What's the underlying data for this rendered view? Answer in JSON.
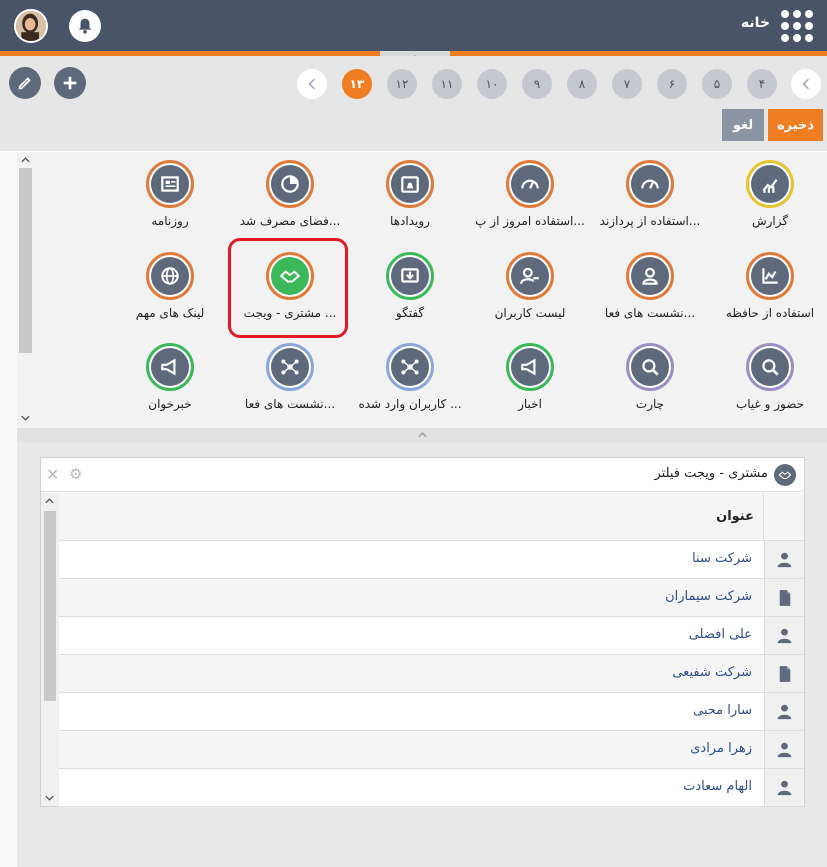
{
  "header": {
    "home_label": "خانه",
    "bell_icon": "bell-icon",
    "grid_icon": "grid-menu-icon"
  },
  "toolbar": {
    "pages": [
      "۱۳",
      "۱۲",
      "۱۱",
      "۱۰",
      "۹",
      "۸",
      "۷",
      "۶",
      "۵",
      "۴"
    ],
    "active_page": "۱۳",
    "save_label": "ذخیره",
    "cancel_label": "لغو"
  },
  "widgets": [
    {
      "label": "گزارش",
      "icon": "chart-up-icon",
      "ring": "#e8c230"
    },
    {
      "label": "استفاده از پردازند...",
      "icon": "gauge-icon",
      "ring": "#e07a3a"
    },
    {
      "label": "استفاده امروز از پ...",
      "icon": "gauge-icon",
      "ring": "#e07a3a"
    },
    {
      "label": "رویدادها",
      "icon": "calendar-bell-icon",
      "ring": "#e07a3a"
    },
    {
      "label": "فضای مصرف شد...",
      "icon": "disk-icon",
      "ring": "#e07a3a"
    },
    {
      "label": "روزنامه",
      "icon": "newspaper-icon",
      "ring": "#e07a3a"
    },
    {
      "label": "استفاده از حافظه",
      "icon": "memory-chart-icon",
      "ring": "#e07a3a"
    },
    {
      "label": "نشست های فعا...",
      "icon": "user-session-icon",
      "ring": "#e07a3a"
    },
    {
      "label": "لیست کاربران",
      "icon": "user-key-icon",
      "ring": "#e07a3a"
    },
    {
      "label": "گفتگو",
      "icon": "chat-download-icon",
      "ring": "#3bb85a"
    },
    {
      "label": "مشتری - ویجت ...",
      "icon": "handshake-icon",
      "ring": "#e07a3a"
    },
    {
      "label": "لینک های مهم",
      "icon": "globe-icon",
      "ring": "#e07a3a"
    },
    {
      "label": "حضور و غیاب",
      "icon": "search-user-icon",
      "ring": "#9b8ec4"
    },
    {
      "label": "چارت",
      "icon": "search-user-icon",
      "ring": "#9b8ec4"
    },
    {
      "label": "اخبار",
      "icon": "megaphone-icon",
      "ring": "#3bb85a"
    },
    {
      "label": "کاربران وارد شده ...",
      "icon": "network-icon",
      "ring": "#8aa6d8"
    },
    {
      "label": "نشست های فعا...",
      "icon": "network-icon",
      "ring": "#8aa6d8"
    },
    {
      "label": "خبرخوان",
      "icon": "megaphone-icon",
      "ring": "#3bb85a"
    }
  ],
  "panel": {
    "title": "مشتری - ویجت فیلتر",
    "column_title": "عنوان",
    "rows": [
      {
        "name": "شرکت سنا",
        "icon": "user-icon"
      },
      {
        "name": "شرکت سیماران",
        "icon": "document-icon"
      },
      {
        "name": "علی افضلی",
        "icon": "user-icon"
      },
      {
        "name": "شرکت شفیعی",
        "icon": "document-icon"
      },
      {
        "name": "سارا محبی",
        "icon": "user-icon"
      },
      {
        "name": "زهرا مرادی",
        "icon": "user-icon"
      },
      {
        "name": "الهام سعادت",
        "icon": "user-icon"
      }
    ]
  }
}
